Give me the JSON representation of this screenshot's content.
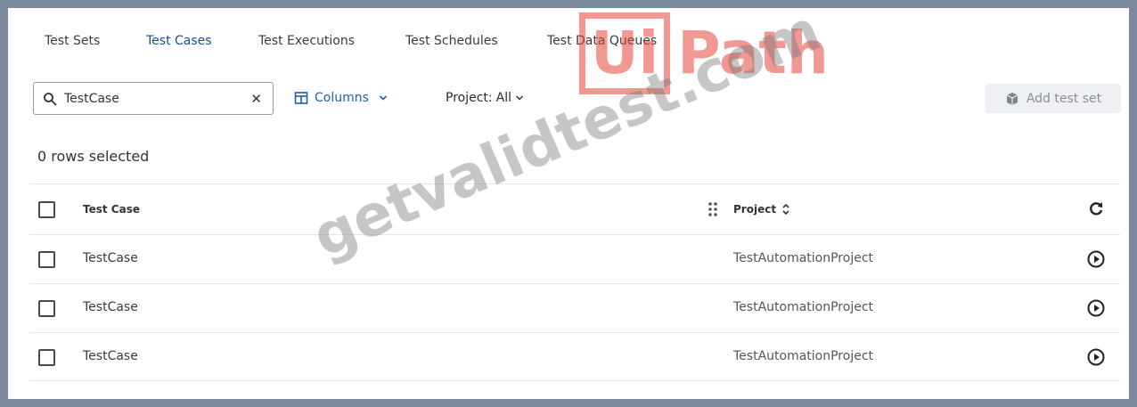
{
  "tabs": [
    {
      "label": "Test Sets",
      "active": false
    },
    {
      "label": "Test Cases",
      "active": true
    },
    {
      "label": "Test Executions",
      "active": false
    },
    {
      "label": "Test Schedules",
      "active": false
    },
    {
      "label": "Test Data Queues",
      "active": false
    }
  ],
  "toolbar": {
    "search_value": "TestCase",
    "clear_icon": "close-icon",
    "columns_label": "Columns",
    "project_label": "Project:",
    "project_value": "All",
    "add_label": "Add test set"
  },
  "selection": {
    "text": "0 rows selected"
  },
  "table": {
    "headers": {
      "name": "Test Case",
      "project": "Project"
    },
    "rows": [
      {
        "name": "TestCase",
        "project": "TestAutomationProject"
      },
      {
        "name": "TestCase",
        "project": "TestAutomationProject"
      },
      {
        "name": "TestCase",
        "project": "TestAutomationProject"
      }
    ]
  },
  "watermarks": {
    "logo_boxed": "Ui",
    "logo_rest": "Path",
    "text": "getvalidtest.com"
  },
  "colors": {
    "accent": "#1f5fa8",
    "frame": "#7a889b",
    "logo": "#e9453a"
  }
}
